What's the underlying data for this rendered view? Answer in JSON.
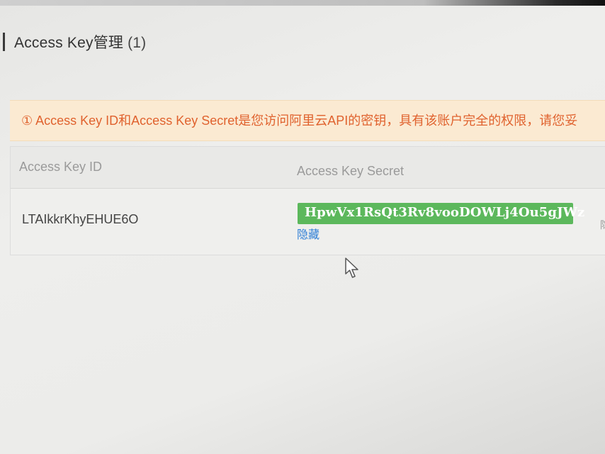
{
  "header": {
    "title": "Access Key管理",
    "count": "(1)"
  },
  "notice": {
    "icon": "info-circle-icon",
    "icon_glyph": "①",
    "text": "Access Key ID和Access Key Secret是您访问阿里云API的密钥，具有该账户完全的权限，请您妥"
  },
  "table": {
    "columns": [
      "Access Key ID",
      "Access Key Secret"
    ],
    "rows": [
      {
        "access_key_id": "LTAIkkrKhyEHUE6O",
        "access_key_secret": "HpwVx1RsQt3Rv8vooDOWLj4Ou5gJWz",
        "hide_label": "隐藏"
      }
    ],
    "cut_off_char": "隐"
  },
  "colors": {
    "notice_bg": "#fbead2",
    "notice_text": "#e0622e",
    "secret_badge": "#5cb85c",
    "link": "#2f7fd6"
  }
}
